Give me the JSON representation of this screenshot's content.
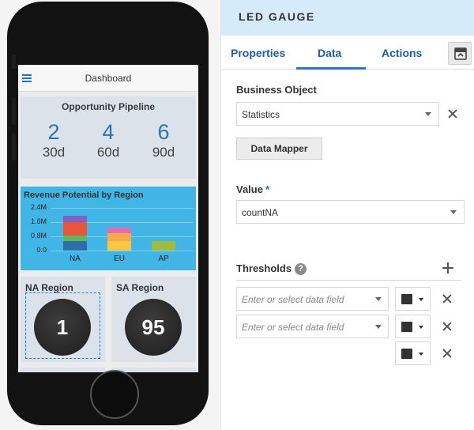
{
  "preview": {
    "app_title": "Dashboard",
    "pipeline": {
      "title": "Opportunity Pipeline",
      "metrics": [
        {
          "count": "2",
          "label": "30d"
        },
        {
          "count": "4",
          "label": "60d"
        },
        {
          "count": "6",
          "label": "90d"
        }
      ]
    },
    "revenue": {
      "title": "Revenue Potential by Region",
      "y_ticks": [
        "2.4M",
        "1.6M",
        "0.8M",
        "0.0"
      ],
      "x_ticks": [
        "NA",
        "EU",
        "AP"
      ]
    },
    "regions": [
      {
        "title": "NA Region",
        "value": "1"
      },
      {
        "title": "SA Region",
        "value": "95"
      }
    ]
  },
  "chart_data": {
    "type": "bar",
    "stacked": true,
    "title": "Revenue Potential by Region",
    "categories": [
      "NA",
      "EU",
      "AP"
    ],
    "ylim": [
      0,
      2.4
    ],
    "y_ticks": [
      "0.0",
      "0.8M",
      "1.6M",
      "2.4M"
    ],
    "series": [
      {
        "color": "#2d6fad",
        "values": [
          0.55,
          0.0,
          0.0
        ]
      },
      {
        "color": "#5cb85c",
        "values": [
          0.3,
          0.0,
          0.0
        ]
      },
      {
        "color": "#e8553b",
        "values": [
          0.75,
          0.0,
          0.0
        ]
      },
      {
        "color": "#8560c4",
        "values": [
          0.35,
          0.0,
          0.0
        ]
      },
      {
        "color": "#f5c842",
        "values": [
          0.0,
          0.55,
          0.0
        ]
      },
      {
        "color": "#f8a94a",
        "values": [
          0.0,
          0.45,
          0.0
        ]
      },
      {
        "color": "#e96ab0",
        "values": [
          0.0,
          0.3,
          0.0
        ]
      },
      {
        "color": "#9ebd3c",
        "values": [
          0.0,
          0.0,
          0.55
        ]
      }
    ]
  },
  "panel": {
    "title": "LED GAUGE",
    "tabs": [
      "Properties",
      "Data",
      "Actions"
    ],
    "active_tab": "Data",
    "business_object": {
      "label": "Business Object",
      "value": "Statistics"
    },
    "data_mapper_label": "Data Mapper",
    "value_field": {
      "label": "Value",
      "required_mark": "*",
      "value": "countNA"
    },
    "thresholds": {
      "label": "Thresholds",
      "help_glyph": "?",
      "rows": [
        {
          "placeholder": "Enter or select data field",
          "color": "#333333"
        },
        {
          "placeholder": "Enter or select data field",
          "color": "#333333"
        },
        {
          "placeholder": "",
          "color": "#333333"
        }
      ]
    }
  },
  "colors": {
    "accent": "#2a76c6",
    "header_bg": "#d6ebfa",
    "revenue_tile": "#41b6e6",
    "led_background": "#222222"
  }
}
